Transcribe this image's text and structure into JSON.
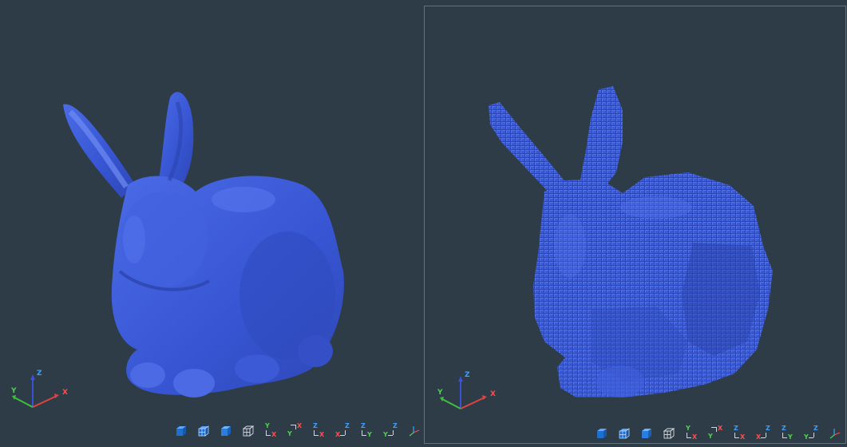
{
  "colors": {
    "background": "#2e3c47",
    "mesh": "#3a5ad6",
    "active_border": "#3d78c4",
    "axis_x": "#ff4d4d",
    "axis_y": "#4fd04f",
    "axis_z": "#3aa0ff"
  },
  "viewports": [
    {
      "model": "bunny-smooth-mesh",
      "active": false,
      "axis": {
        "x": "X",
        "y": "Y",
        "z": "Z"
      },
      "toolbar": {
        "shade_icons": [
          "shaded-cube-icon",
          "shaded-edges-cube-icon",
          "shaded-cube-alt-icon",
          "wireframe-cube-icon"
        ],
        "views": [
          {
            "a": "Y",
            "b": "X"
          },
          {
            "a": "X",
            "b": "Y"
          },
          {
            "a": "Z",
            "b": "X"
          },
          {
            "a": "Z",
            "b": "X"
          },
          {
            "a": "Z",
            "b": "Y"
          },
          {
            "a": "Z",
            "b": "Y"
          }
        ],
        "iso_icon": "isometric-axes-icon"
      }
    },
    {
      "model": "bunny-voxel-mesh",
      "active": true,
      "axis": {
        "x": "X",
        "y": "Y",
        "z": "Z"
      },
      "toolbar": {
        "shade_icons": [
          "shaded-cube-icon",
          "shaded-edges-cube-icon",
          "shaded-cube-alt-icon",
          "wireframe-cube-icon"
        ],
        "views": [
          {
            "a": "Y",
            "b": "X"
          },
          {
            "a": "X",
            "b": "Y"
          },
          {
            "a": "Z",
            "b": "X"
          },
          {
            "a": "Z",
            "b": "X"
          },
          {
            "a": "Z",
            "b": "Y"
          },
          {
            "a": "Z",
            "b": "Y"
          }
        ],
        "iso_icon": "isometric-axes-icon"
      }
    }
  ]
}
